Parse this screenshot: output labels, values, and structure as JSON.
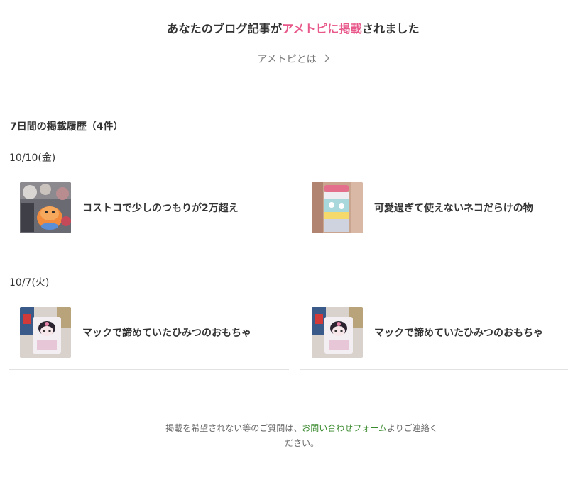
{
  "banner": {
    "title_before": "あなたのブログ記事が",
    "title_highlight": "アメトピに掲載",
    "title_after": "されました",
    "link_label": "アメトピとは",
    "highlight_color": "#e8588b"
  },
  "history": {
    "heading": "7日間の掲載履歴（4件）",
    "groups": [
      {
        "date": "10/10(金)",
        "articles": [
          {
            "title": "コストコで少しのつもりが2万超え",
            "thumbnail": "photo-plush-cat"
          },
          {
            "title": "可愛過ぎて使えないネコだらけの物",
            "thumbnail": "photo-pink-bottle"
          }
        ]
      },
      {
        "date": "10/7(火)",
        "articles": [
          {
            "title": "マックで諦めていたひみつのおもちゃ",
            "thumbnail": "photo-kuromi-toy"
          },
          {
            "title": "マックで諦めていたひみつのおもちゃ",
            "thumbnail": "photo-kuromi-toy"
          }
        ]
      }
    ]
  },
  "footer": {
    "text_before": "掲載を希望されない等のご質問は、",
    "link_label": "お問い合わせフォーム",
    "text_after": "よりご連絡く",
    "text_line2": "ださい。",
    "link_color": "#3a8a2e"
  }
}
